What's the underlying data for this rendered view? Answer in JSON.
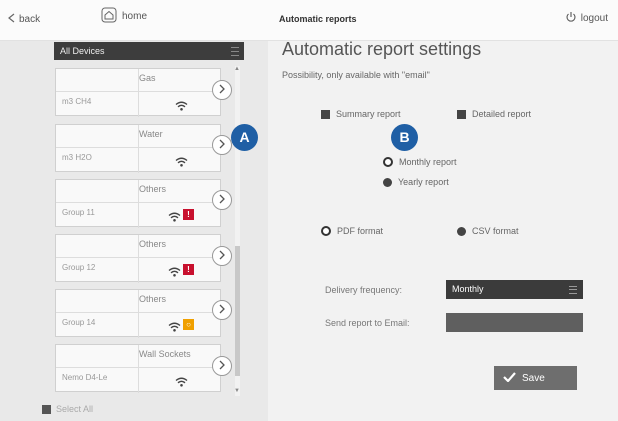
{
  "topbar": {
    "back_label": "back",
    "home_label": "home",
    "title": "Automatic reports",
    "logout_label": "logout"
  },
  "sidebar": {
    "device_select": "All Devices",
    "devices": [
      {
        "type": "Gas",
        "name": "m3 CH4",
        "badge": ""
      },
      {
        "type": "Water",
        "name": "m3 H2O",
        "badge": ""
      },
      {
        "type": "Others",
        "name": "Group 11",
        "badge": "!"
      },
      {
        "type": "Others",
        "name": "Group 12",
        "badge": "!"
      },
      {
        "type": "Others",
        "name": "Group 14",
        "badge": "○"
      },
      {
        "type": "Wall Sockets",
        "name": "Nemo D4-Le",
        "badge": ""
      }
    ],
    "select_all": "Select All"
  },
  "callouts": {
    "a": "A",
    "b": "B"
  },
  "main": {
    "title": "Automatic report settings",
    "subtitle": "Possibility, only available with \"email\"",
    "summary_report": "Summary report",
    "detailed_report": "Detailed report",
    "monthly_report": "Monthly report",
    "yearly_report": "Yearly report",
    "pdf_format": "PDF format",
    "csv_format": "CSV format",
    "delivery_label": "Delivery frequency:",
    "delivery_value": "Monthly",
    "email_label": "Send report to Email:",
    "email_value": "",
    "save_label": "Save"
  },
  "colors": {
    "badge_red": "#c8102e",
    "badge_orange": "#f0a000",
    "callout_blue": "#1f5fa5"
  }
}
